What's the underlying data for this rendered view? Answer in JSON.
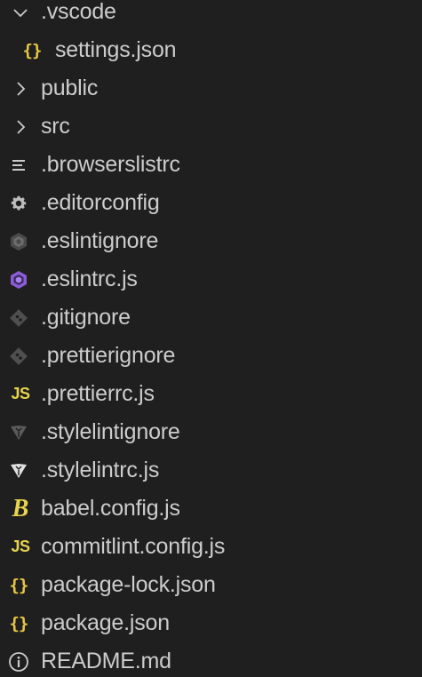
{
  "explorer": {
    "items": [
      {
        "name": ".vscode",
        "kind": "folder-open",
        "icon": "chevron-down-icon",
        "depth": 0
      },
      {
        "name": "settings.json",
        "kind": "file",
        "icon": "json-icon",
        "depth": 1
      },
      {
        "name": "public",
        "kind": "folder-closed",
        "icon": "chevron-right-icon",
        "depth": 0
      },
      {
        "name": "src",
        "kind": "folder-closed",
        "icon": "chevron-right-icon",
        "depth": 0
      },
      {
        "name": ".browserslistrc",
        "kind": "file",
        "icon": "text-lines-icon",
        "depth": 0
      },
      {
        "name": ".editorconfig",
        "kind": "file",
        "icon": "gear-icon",
        "depth": 0
      },
      {
        "name": ".eslintignore",
        "kind": "file",
        "icon": "eslint-gray-icon",
        "depth": 0
      },
      {
        "name": ".eslintrc.js",
        "kind": "file",
        "icon": "eslint-icon",
        "depth": 0
      },
      {
        "name": ".gitignore",
        "kind": "file",
        "icon": "git-icon",
        "depth": 0
      },
      {
        "name": ".prettierignore",
        "kind": "file",
        "icon": "git-icon",
        "depth": 0
      },
      {
        "name": ".prettierrc.js",
        "kind": "file",
        "icon": "js-icon",
        "depth": 0
      },
      {
        "name": ".stylelintignore",
        "kind": "file",
        "icon": "stylelint-gray-icon",
        "depth": 0
      },
      {
        "name": ".stylelintrc.js",
        "kind": "file",
        "icon": "stylelint-icon",
        "depth": 0
      },
      {
        "name": "babel.config.js",
        "kind": "file",
        "icon": "babel-icon",
        "depth": 0
      },
      {
        "name": "commitlint.config.js",
        "kind": "file",
        "icon": "js-icon",
        "depth": 0
      },
      {
        "name": "package-lock.json",
        "kind": "file",
        "icon": "json-icon",
        "depth": 0
      },
      {
        "name": "package.json",
        "kind": "file",
        "icon": "json-icon",
        "depth": 0
      },
      {
        "name": "README.md",
        "kind": "file",
        "icon": "info-icon",
        "depth": 0
      }
    ]
  },
  "icons": {
    "json_glyph": "{}",
    "js_glyph": "JS",
    "babel_glyph": "B"
  },
  "colors": {
    "background": "#1f1f1f",
    "text": "#cccccc",
    "json_yellow": "#e8c742",
    "js_yellow": "#e8d44d",
    "eslint_purple": "#8b5cd6",
    "gray_icon": "#6d6d6d",
    "stylelint_white": "#e0e0e0"
  }
}
